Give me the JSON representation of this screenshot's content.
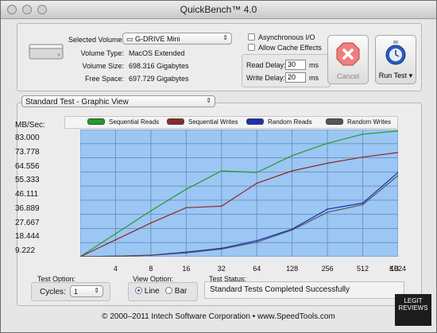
{
  "window": {
    "title": "QuickBench™ 4.0"
  },
  "volume": {
    "selected_label": "Selected Volume:",
    "selected_value": "G-DRIVE Mini",
    "type_label": "Volume Type:",
    "type_value": "MacOS Extended",
    "size_label": "Volume Size:",
    "size_value": "698.316 Gigabytes",
    "free_label": "Free Space:",
    "free_value": "697.729 Gigabytes"
  },
  "options": {
    "async_label": "Asynchronous I/O",
    "cache_label": "Allow Cache Effects",
    "read_delay_label": "Read Delay:",
    "read_delay_value": "30",
    "read_delay_unit": "ms",
    "write_delay_label": "Write Delay:",
    "write_delay_value": "20",
    "write_delay_unit": "ms"
  },
  "buttons": {
    "cancel": "Cancel",
    "run": "Run Test"
  },
  "view_select": "Standard Test - Graphic View",
  "legend": [
    "Sequential Reads",
    "Sequential Writes",
    "Random Reads",
    "Random Writes"
  ],
  "colors": {
    "sequential_reads": "#1e9e2b",
    "sequential_writes": "#8a2a2a",
    "random_reads": "#1830b8",
    "random_writes": "#555555",
    "plot_bg": "#9cc6f3"
  },
  "chart_data": {
    "type": "line",
    "ylabel": "MB/Sec:",
    "xlabel": "KB",
    "ylim": [
      0,
      83
    ],
    "yticks": [
      "83.000",
      "73.778",
      "64.556",
      "55.333",
      "46.111",
      "36.889",
      "27.667",
      "18.444",
      "9.222"
    ],
    "categories": [
      "4",
      "8",
      "16",
      "32",
      "64",
      "128",
      "256",
      "512",
      "1024"
    ],
    "series": [
      {
        "name": "Sequential Reads",
        "color": "#1e9e2b",
        "values": [
          15,
          30,
          44,
          56,
          55,
          66,
          74,
          80,
          82
        ]
      },
      {
        "name": "Sequential Writes",
        "color": "#8a2a2a",
        "values": [
          11,
          22,
          32,
          33,
          48,
          56,
          61,
          65,
          68
        ]
      },
      {
        "name": "Random Reads",
        "color": "#1830b8",
        "values": [
          0.3,
          1.0,
          3.0,
          5.5,
          10.5,
          18.0,
          31.0,
          35.0,
          55.0
        ]
      },
      {
        "name": "Random Writes",
        "color": "#555555",
        "values": [
          0.3,
          0.9,
          2.5,
          5.0,
          9.5,
          17.5,
          29.0,
          34.0,
          53.0
        ]
      }
    ]
  },
  "test_option": {
    "label": "Test Option:",
    "cycles_label": "Cycles:",
    "cycles_value": "1"
  },
  "view_option": {
    "label": "View Option:",
    "line": "Line",
    "bar": "Bar",
    "selected": "Line"
  },
  "test_status": {
    "label": "Test Status:",
    "value": "Standard Tests Completed Successfully"
  },
  "footer": "© 2000–2011 Intech Software Corporation • www.SpeedTools.com",
  "watermark": "LEGIT REVIEWS"
}
